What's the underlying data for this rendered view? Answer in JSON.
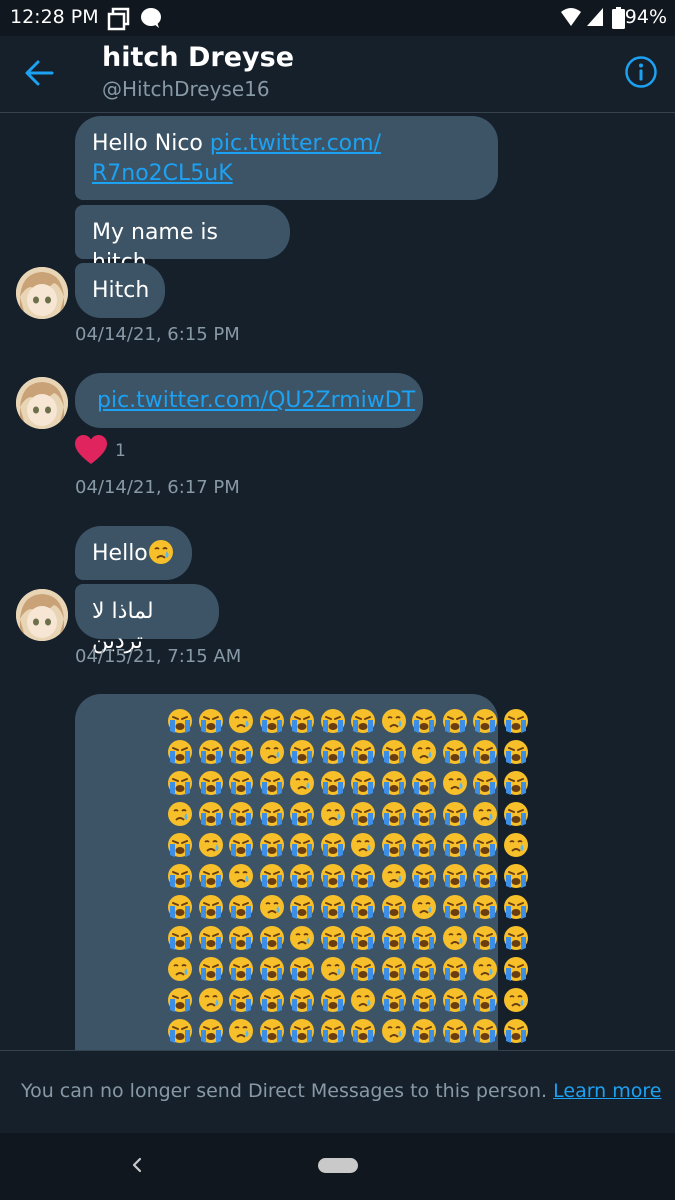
{
  "status_bar": {
    "time": "12:28 PM",
    "battery": "94%",
    "icons": [
      "screenshot-icon",
      "chat-bubble-icon",
      "wifi-icon",
      "signal-icon",
      "battery-icon"
    ]
  },
  "header": {
    "name": "hitch Dreyse",
    "handle": "@HitchDreyse16",
    "back_icon": "arrow-left-icon",
    "info_icon": "info-icon",
    "accent_color": "#1da1f2"
  },
  "messages": {
    "group1": {
      "m1_text": "Hello Nico ",
      "m1_link_line1": "pic.twitter.com/",
      "m1_link_line2": "R7no2CL5uK",
      "m2_text": "My name is hitch",
      "m3_text": "Hitch",
      "timestamp": "04/14/21, 6:15 PM"
    },
    "group2": {
      "link": "pic.twitter.com/QU2ZrmiwDT",
      "reaction_icon": "heart-icon",
      "reaction_count": "1",
      "timestamp": "04/14/21, 6:17 PM"
    },
    "group3": {
      "m1_text": "Hello",
      "m1_emoji": "crying-face-emoji",
      "m2_text": "لماذا لا تردين",
      "timestamp": "04/15/21, 7:15 AM"
    },
    "group4": {
      "emoji_name": "crying-faces-emoji-grid"
    }
  },
  "footer": {
    "notice": "You can no longer send Direct Messages to this person. ",
    "learn_more": "Learn more"
  },
  "colors": {
    "background": "#15202b",
    "bubble": "#3d5466",
    "muted_text": "#8899a6",
    "link": "#1da1f2",
    "heart": "#e0245e"
  }
}
